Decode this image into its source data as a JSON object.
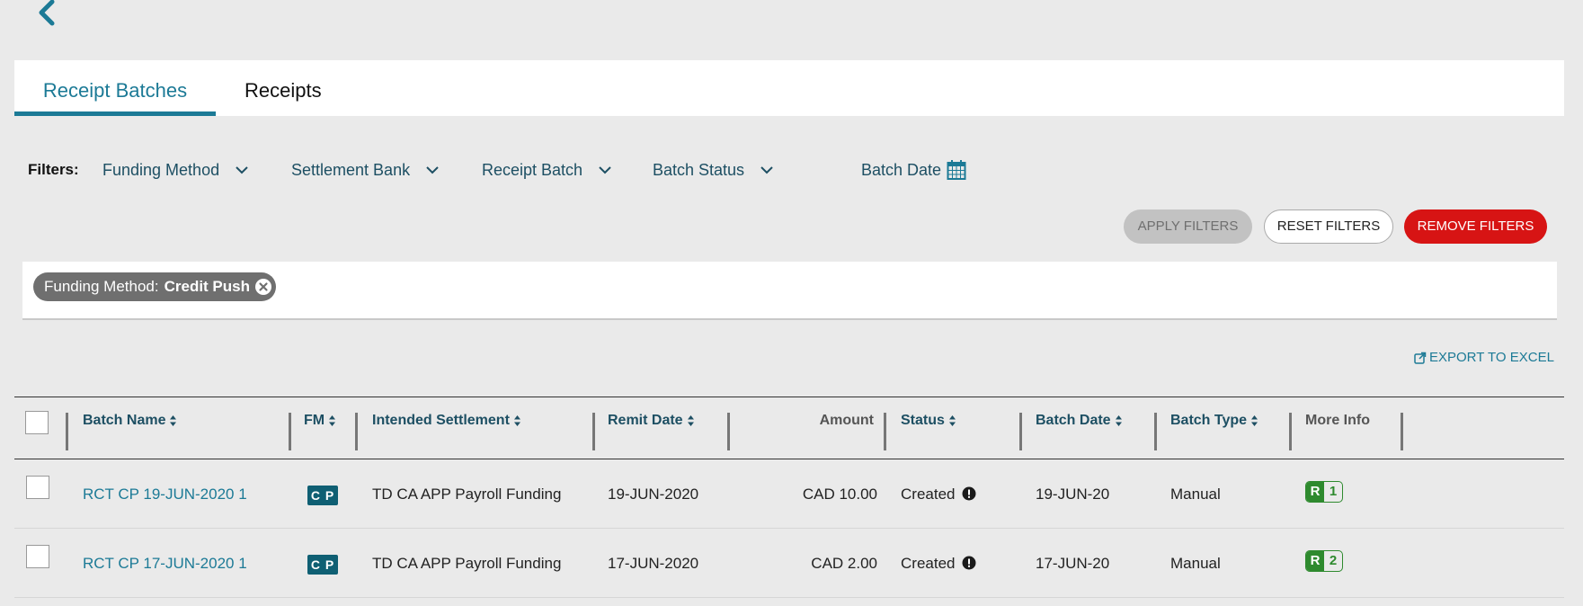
{
  "tabs": [
    {
      "label": "Receipt Batches",
      "active": true
    },
    {
      "label": "Receipts",
      "active": false
    }
  ],
  "filters": {
    "label": "Filters:",
    "items": [
      "Funding Method",
      "Settlement Bank",
      "Receipt Batch",
      "Batch Status"
    ],
    "date_label": "Batch Date"
  },
  "buttons": {
    "apply": "APPLY FILTERS",
    "reset": "RESET FILTERS",
    "remove": "REMOVE FILTERS"
  },
  "chip": {
    "key": "Funding Method:",
    "value": "Credit Push"
  },
  "export_label": "EXPORT TO EXCEL",
  "table": {
    "columns": {
      "batch_name": "Batch Name",
      "fm": "FM",
      "intended_settlement": "Intended Settlement",
      "remit_date": "Remit Date",
      "amount": "Amount",
      "status": "Status",
      "batch_date": "Batch Date",
      "batch_type": "Batch Type",
      "more_info": "More Info"
    },
    "rows": [
      {
        "batch_name": "RCT CP 19-JUN-2020 1",
        "fm": "C P",
        "intended_settlement": "TD CA APP Payroll Funding",
        "remit_date": "19-JUN-2020",
        "amount": "CAD 10.00",
        "status": "Created",
        "batch_date": "19-JUN-20",
        "batch_type": "Manual",
        "info_letter": "R",
        "info_count": "1"
      },
      {
        "batch_name": "RCT CP 17-JUN-2020 1",
        "fm": "C P",
        "intended_settlement": "TD CA APP Payroll Funding",
        "remit_date": "17-JUN-2020",
        "amount": "CAD 2.00",
        "status": "Created",
        "batch_date": "17-JUN-20",
        "batch_type": "Manual",
        "info_letter": "R",
        "info_count": "2"
      }
    ]
  },
  "colors": {
    "accent": "#1c7a96",
    "remove_button": "#d71414",
    "fm_badge": "#0f5f73",
    "info_badge": "#2e8a2e"
  }
}
